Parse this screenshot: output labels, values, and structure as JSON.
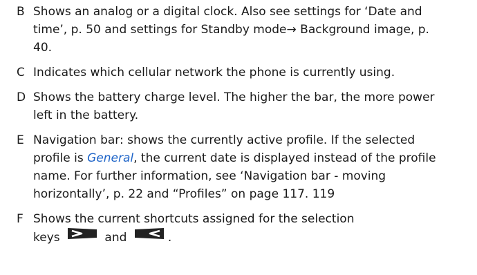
{
  "entries": [
    {
      "letter": "B",
      "lines": [
        "Shows an analog or a digital clock. Also see settings for ‘Date and",
        "time’, p. 50 and settings for Standby mode→ Background image, p.",
        "40."
      ]
    },
    {
      "letter": "C",
      "lines": [
        "Indicates which cellular network the phone is currently using."
      ]
    },
    {
      "letter": "D",
      "lines": [
        "Shows the battery charge level. The higher the bar, the more power",
        "left in the battery."
      ]
    },
    {
      "letter": "E",
      "line1": "Navigation bar: shows the currently active profile. If the selected",
      "line2_before": "profile is ",
      "line2_emph": "General",
      "line2_after": ", the current date is displayed instead of the profile",
      "line3": "name. For further information, see ‘Navigation bar - moving",
      "line4": "horizontally’, p. 22 and “Profiles” on page 117. 119"
    },
    {
      "letter": "F",
      "line1": "Shows the current shortcuts assigned for the selection",
      "line2_before": "keys ",
      "line2_middle": " and ",
      "line2_after": ".",
      "icons": [
        "left-selection-key-icon",
        "right-selection-key-icon"
      ]
    }
  ],
  "colors": {
    "text": "#1a1a1a",
    "emphasis": "#1e64c8",
    "key_icon": "#222222"
  }
}
